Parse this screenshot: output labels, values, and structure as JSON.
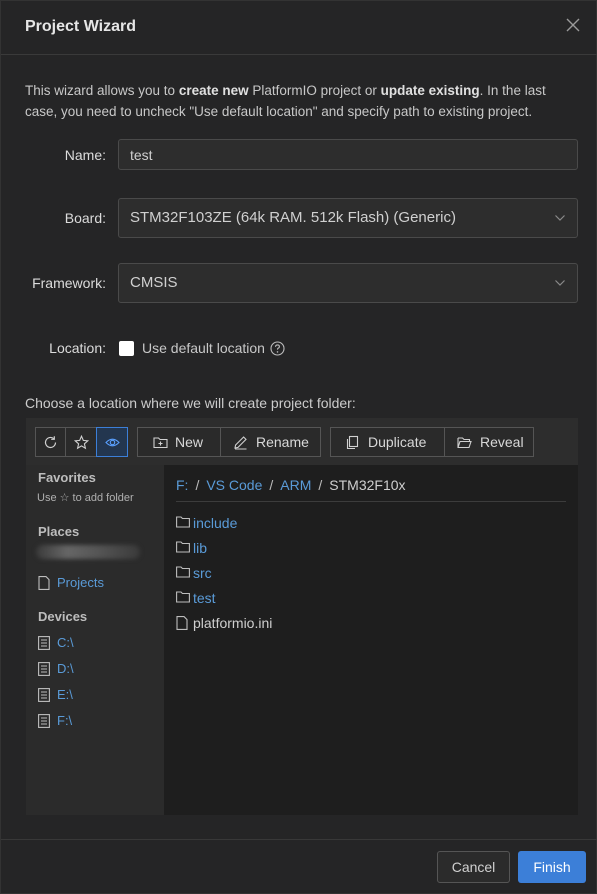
{
  "dialog": {
    "title": "Project Wizard",
    "intro": {
      "part1": "This wizard allows you to ",
      "bold1": "create new",
      "part2": " PlatformIO project or ",
      "bold2": "update existing",
      "part3": ". In the last case, you need to uncheck \"Use default location\" and specify path to existing project."
    }
  },
  "form": {
    "name_label": "Name:",
    "name_value": "test",
    "board_label": "Board:",
    "board_value": "STM32F103ZE (64k RAM. 512k Flash) (Generic)",
    "framework_label": "Framework:",
    "framework_value": "CMSIS",
    "location_label": "Location:",
    "use_default_label": "Use default location",
    "use_default_checked": false
  },
  "browser": {
    "prompt": "Choose a location where we will create project folder:",
    "toolbar": {
      "new_label": "New",
      "rename_label": "Rename",
      "duplicate_label": "Duplicate",
      "reveal_label": "Reveal"
    },
    "sidebar": {
      "favorites_heading": "Favorites",
      "favorites_hint": "Use ☆ to add folder",
      "places_heading": "Places",
      "projects_label": "Projects",
      "devices_heading": "Devices",
      "devices": [
        "C:\\",
        "D:\\",
        "E:\\",
        "F:\\"
      ]
    },
    "breadcrumb": [
      "F:",
      "VS Code",
      "ARM",
      "STM32F10x"
    ],
    "folders": [
      "include",
      "lib",
      "src",
      "test"
    ],
    "files": [
      "platformio.ini"
    ]
  },
  "footer": {
    "cancel_label": "Cancel",
    "finish_label": "Finish"
  },
  "colors": {
    "accent": "#3c7fd8",
    "link": "#5a9bd8",
    "background": "#252526"
  }
}
